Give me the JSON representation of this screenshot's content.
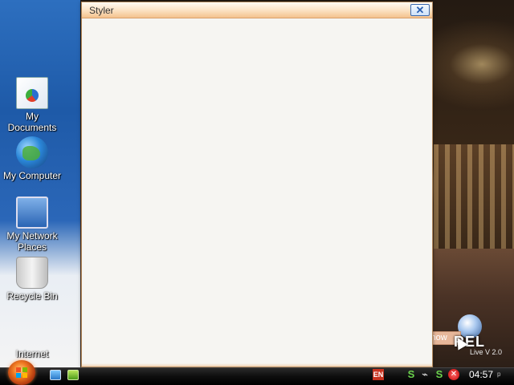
{
  "desktop": {
    "icons": [
      {
        "label": "My Documents",
        "icon": "documents-icon"
      },
      {
        "label": "My Computer",
        "icon": "computer-icon"
      },
      {
        "label": "My Network Places",
        "icon": "network-icon"
      },
      {
        "label": "Recycle Bin",
        "icon": "recycle-bin-icon"
      },
      {
        "label": "Internet",
        "icon": "internet-icon"
      }
    ]
  },
  "window": {
    "title": "Styler",
    "close_glyph": "✕"
  },
  "overlay": {
    "show_label": "show",
    "brand_text": "REL",
    "brand_sub": "Live V 2.0"
  },
  "taskbar": {
    "start_icon": "windows-logo-icon",
    "quick_launch": [
      "show-desktop-icon",
      "media-player-icon"
    ],
    "tray": {
      "language": "EN",
      "icons": [
        "network-status-icon",
        "volume-icon",
        "security-icon",
        "antivirus-icon"
      ]
    },
    "clock": "04:57",
    "clock_suffix": "p"
  },
  "colors": {
    "titlebar_top": "#fffaf4",
    "titlebar_bottom": "#f4c28e",
    "window_body": "#f6f5f2",
    "taskbar": "#000000",
    "desktop_panel": "#2d6fbf"
  }
}
